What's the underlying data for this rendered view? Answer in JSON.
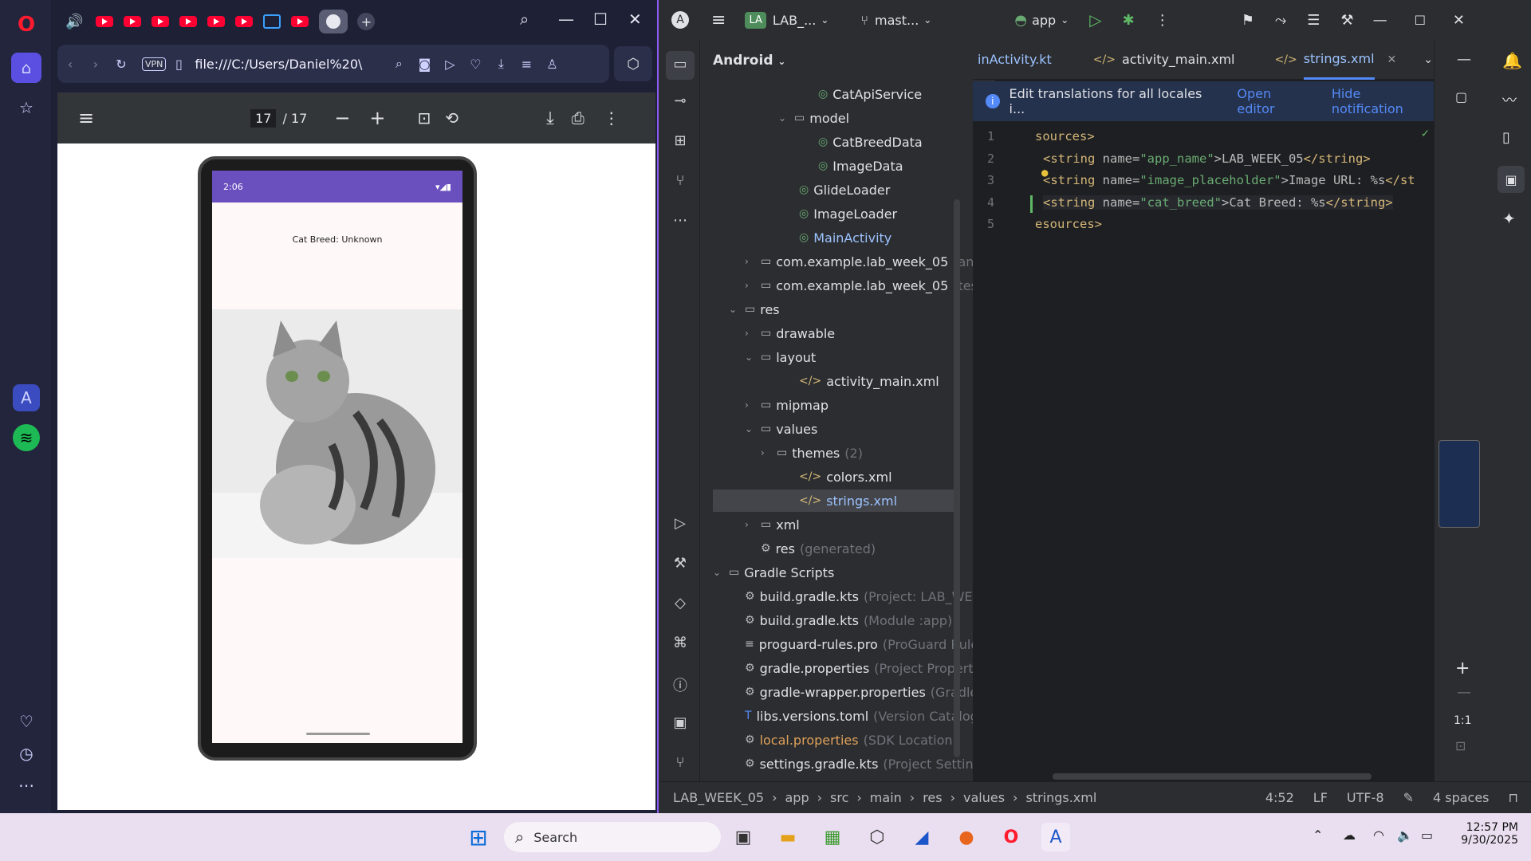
{
  "browser": {
    "tab_count_youtube": 8,
    "url": "file:///C:/Users/Daniel%20\\",
    "vpn_label": "VPN"
  },
  "pdf": {
    "page_current": "17",
    "page_total": "/ 17"
  },
  "phone": {
    "status_time": "2:06",
    "text": "Cat Breed: Unknown"
  },
  "studio": {
    "project_name": "LAB_...",
    "project_badge": "LA",
    "branch": "mast...",
    "run_config": "app",
    "view": "Android",
    "tabs": [
      {
        "label": "inActivity.kt"
      },
      {
        "label": "activity_main.xml"
      },
      {
        "label": "strings.xml"
      }
    ],
    "notification": "Edit translations for all locales i...",
    "notify_action1": "Open editor",
    "notify_action2": "Hide notification",
    "tree": [
      {
        "label": "CatApiService",
        "muted": ""
      },
      {
        "label": "model",
        "muted": ""
      },
      {
        "label": "CatBreedData",
        "muted": ""
      },
      {
        "label": "ImageData",
        "muted": ""
      },
      {
        "label": "GlideLoader",
        "muted": ""
      },
      {
        "label": "ImageLoader",
        "muted": ""
      },
      {
        "label": "MainActivity",
        "muted": ""
      },
      {
        "label": "com.example.lab_week_05",
        "muted": "(andr"
      },
      {
        "label": "com.example.lab_week_05",
        "muted": "(test)"
      },
      {
        "label": "res",
        "muted": ""
      },
      {
        "label": "drawable",
        "muted": ""
      },
      {
        "label": "layout",
        "muted": ""
      },
      {
        "label": "activity_main.xml",
        "muted": ""
      },
      {
        "label": "mipmap",
        "muted": ""
      },
      {
        "label": "values",
        "muted": ""
      },
      {
        "label": "themes",
        "muted": "(2)"
      },
      {
        "label": "colors.xml",
        "muted": ""
      },
      {
        "label": "strings.xml",
        "muted": ""
      },
      {
        "label": "xml",
        "muted": ""
      },
      {
        "label": "res",
        "muted": "(generated)"
      },
      {
        "label": "Gradle Scripts",
        "muted": ""
      },
      {
        "label": "build.gradle.kts",
        "muted": "(Project: LAB_WEEK"
      },
      {
        "label": "build.gradle.kts",
        "muted": "(Module :app)"
      },
      {
        "label": "proguard-rules.pro",
        "muted": "(ProGuard Rules"
      },
      {
        "label": "gradle.properties",
        "muted": "(Project Properties"
      },
      {
        "label": "gradle-wrapper.properties",
        "muted": "(Gradle V"
      },
      {
        "label": "libs.versions.toml",
        "muted": "(Version Catalog"
      },
      {
        "label": "local.properties",
        "muted": "(SDK Location)"
      },
      {
        "label": "settings.gradle.kts",
        "muted": "(Project Settings"
      }
    ],
    "code": [
      {
        "n": "1",
        "tag_open": "sources>",
        "attr": "",
        "val": "",
        "text": "",
        "tag_close": ""
      },
      {
        "n": "2",
        "tag_open": "<string",
        "attr": " name=",
        "val": "\"app_name\"",
        "text": ">LAB_WEEK_05",
        "tag_close": "</string>"
      },
      {
        "n": "3",
        "tag_open": "<string",
        "attr": " name=",
        "val": "\"image_placeholder\"",
        "text": ">Image URL: %s",
        "tag_close": "</st"
      },
      {
        "n": "4",
        "tag_open": "<string",
        "attr": " name=",
        "val": "\"cat_breed\"",
        "text": ">Cat Breed: %s",
        "tag_close": "</string>"
      },
      {
        "n": "5",
        "tag_open": "esources>",
        "attr": "",
        "val": "",
        "text": "",
        "tag_close": ""
      }
    ],
    "zoom_label": "1:1",
    "breadcrumb": [
      "LAB_WEEK_05",
      "app",
      "src",
      "main",
      "res",
      "values",
      "strings.xml"
    ],
    "position": "4:52",
    "line_sep": "LF",
    "encoding": "UTF-8",
    "indent": "4 spaces"
  },
  "taskbar": {
    "search_placeholder": "Search",
    "time": "12:57 PM",
    "date": "9/30/2025"
  },
  "colors": {
    "opera_red": "#ff1b2d",
    "studio_bg": "#1e1f22",
    "accent_blue": "#548af7"
  }
}
